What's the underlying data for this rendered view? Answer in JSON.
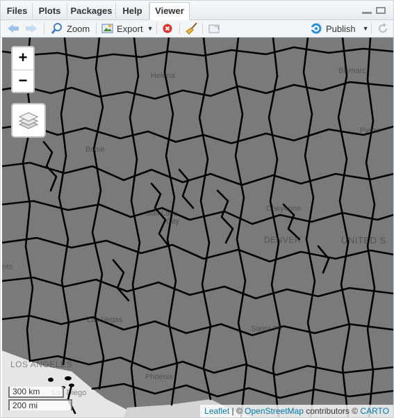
{
  "tabs": [
    "Files",
    "Plots",
    "Packages",
    "Help",
    "Viewer"
  ],
  "active_tab": "Viewer",
  "toolbar": {
    "zoom_label": "Zoom",
    "export_label": "Export",
    "publish_label": "Publish"
  },
  "map": {
    "zoom_in": "+",
    "zoom_out": "−",
    "cities": {
      "helena": "Helena",
      "bismarck": "Bismarc",
      "boise": "Boise",
      "pierre": "Pierre",
      "salt_lake": "Salt Lake",
      "salt_lake_city": "City",
      "cheyenne": "Cheyenne",
      "denver": "DENVER",
      "united_states": "UNITED S",
      "sacramento_fragment": "nto",
      "las_vegas": "Las Vegas",
      "santa_fe": "Santa Fe",
      "los_angeles": "LOS ANGELES",
      "phoenix": "Phoenix",
      "san_diego": "San Diego"
    },
    "scale_km": "300 km",
    "scale_mi": "200 mi",
    "attribution": {
      "leaflet": "Leaflet",
      "sep": " | © ",
      "osm": "OpenStreetMap",
      "contrib": " contributors © ",
      "carto": "CARTO"
    }
  },
  "colors": {
    "polygon_fill": "#7a7a7a",
    "boundary": "#000000",
    "ocean": "#e6e6e6",
    "accent_link": "#0078a8",
    "publish_blue": "#2b8fd6"
  }
}
